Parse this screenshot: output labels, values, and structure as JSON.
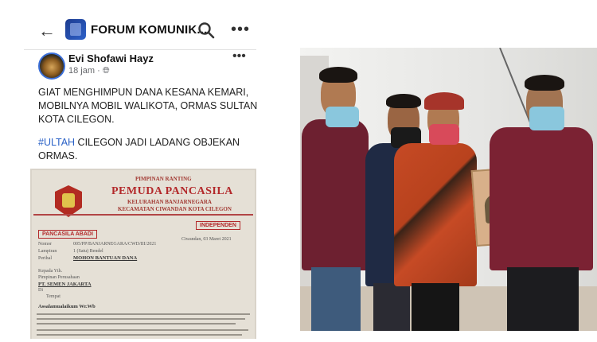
{
  "header": {
    "back_icon": "arrow-left-icon",
    "group_title": "FORUM KOMUNIK...",
    "search_icon": "search-icon",
    "more_icon": "more-horizontal-icon"
  },
  "post": {
    "author": "Evi Shofawi Hayz",
    "time": "18 jam",
    "privacy_icon": "globe-icon",
    "paragraph1": "GIAT MENGHIMPUN DANA KESANA KEMARI, MOBILNYA MOBIL WALIKOTA, ORMAS SULTAN KOTA CILEGON.",
    "hashtag": "#ULTAH",
    "paragraph2_rest": " CILEGON JADI LADANG OBJEKAN ORMAS."
  },
  "document": {
    "top_small": "PIMPINAN RANTING",
    "title": "PEMUDA PANCASILA",
    "sub1": "KELURAHAN BANJARNEGARA",
    "sub2": "KECAMATAN CIWANDAN KOTA CILEGON",
    "stamp_left": "PANCASILA ABADI",
    "stamp_right": "INDEPENDEN",
    "nomor_label": "Nomor",
    "nomor_value": "005/PP/BANJARNEGARA/CWD/III/2021",
    "lampiran_label": "Lampiran",
    "lampiran_value": "1 (Satu) Bendel",
    "perihal_label": "Perihal",
    "perihal_value": "MOHON BANTUAN DANA",
    "date": "Ciwandan, 03 Maret 2021",
    "kepada": "Kepada Yth.",
    "pimpinan": "Pimpinan Perusahaan",
    "recipient": "PT. SEMEN JAKARTA",
    "di": "Di",
    "tempat": "Tempat",
    "salam": "Assalamualaikum Wr.Wb"
  },
  "colors": {
    "hashtag": "#2b62c7",
    "doc_red": "#b3292b"
  }
}
